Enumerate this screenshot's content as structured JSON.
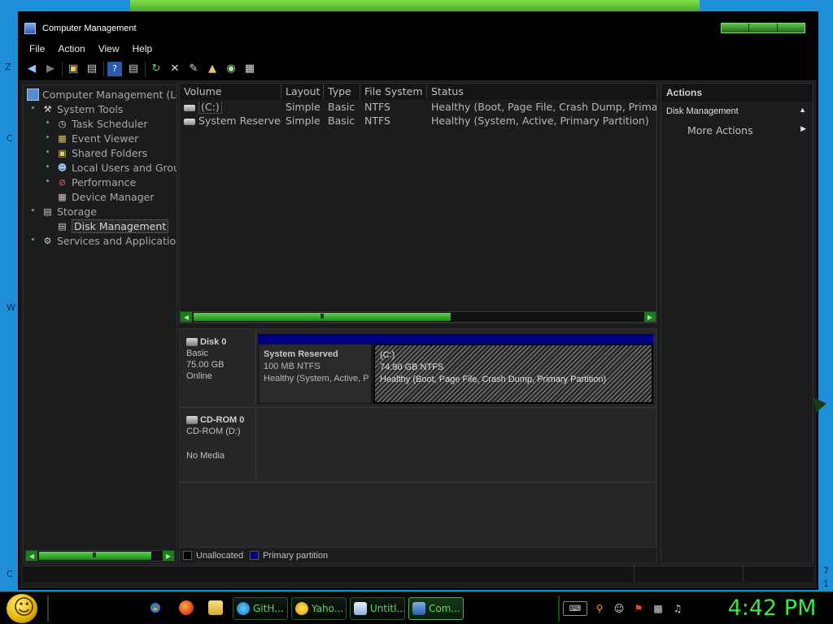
{
  "desktop": {
    "edge_letters": [
      "Z",
      "C",
      "W",
      "C",
      "7",
      "1"
    ]
  },
  "window": {
    "title": "Computer Management",
    "menu": [
      "File",
      "Action",
      "View",
      "Help"
    ]
  },
  "toolbar": {
    "icons": [
      "back-icon",
      "forward-icon",
      "up-folder-icon",
      "show-hide-tree-icon",
      "help-icon",
      "properties-icon",
      "refresh-icon",
      "delete-icon",
      "settings-icon",
      "open-icon",
      "search-icon",
      "export-icon"
    ]
  },
  "tree": {
    "items": [
      {
        "label": "Computer Management (Loc",
        "level": 0,
        "icon": "computer-icon"
      },
      {
        "label": "System Tools",
        "level": 1,
        "icon": "tools-icon"
      },
      {
        "label": "Task Scheduler",
        "level": 2,
        "icon": "clock-icon"
      },
      {
        "label": "Event Viewer",
        "level": 2,
        "icon": "event-viewer-icon"
      },
      {
        "label": "Shared Folders",
        "level": 2,
        "icon": "shared-folder-icon"
      },
      {
        "label": "Local Users and Grou",
        "level": 2,
        "icon": "users-icon"
      },
      {
        "label": "Performance",
        "level": 2,
        "icon": "performance-icon"
      },
      {
        "label": "Device Manager",
        "level": 2,
        "icon": "device-manager-icon"
      },
      {
        "label": "Storage",
        "level": 1,
        "icon": "storage-icon"
      },
      {
        "label": "Disk Management",
        "level": 2,
        "icon": "disk-icon"
      },
      {
        "label": "Services and Applications",
        "level": 1,
        "icon": "services-icon"
      }
    ],
    "selected_index": 9
  },
  "volumes": {
    "columns": [
      "Volume",
      "Layout",
      "Type",
      "File System",
      "Status"
    ],
    "rows": [
      {
        "volume": "(C:)",
        "layout": "Simple",
        "type": "Basic",
        "fs": "NTFS",
        "status": "Healthy (Boot, Page File, Crash Dump, Primary"
      },
      {
        "volume": "System Reserved",
        "layout": "Simple",
        "type": "Basic",
        "fs": "NTFS",
        "status": "Healthy (System, Active, Primary Partition)"
      }
    ]
  },
  "disks": [
    {
      "name": "Disk 0",
      "lines": [
        "Basic",
        "75.00 GB",
        "Online"
      ],
      "partitions": [
        {
          "title": "System Reserved",
          "size": "100 MB NTFS",
          "status": "Healthy (System, Active, P"
        },
        {
          "title": "(C:)",
          "size": "74.90 GB NTFS",
          "status": "Healthy (Boot, Page File, Crash Dump, Primary Partition)"
        }
      ]
    },
    {
      "name": "CD-ROM 0",
      "lines": [
        "CD-ROM (D:)",
        "",
        "No Media"
      ]
    }
  ],
  "legend": {
    "unallocated": "Unallocated",
    "primary": "Primary partition",
    "unallocated_color": "#000000",
    "primary_color": "#000080"
  },
  "actions": {
    "header": "Actions",
    "section": "Disk Management",
    "item": "More Actions"
  },
  "taskbar": {
    "buttons": [
      {
        "label": "GitH...",
        "color": "#1f8fe0"
      },
      {
        "label": "Yaho...",
        "color": "#f0c020"
      },
      {
        "label": "Untitl...",
        "color": "#8fb0d8"
      },
      {
        "label": "Com...",
        "color": "#4a80d0"
      }
    ],
    "clock": "4:42 PM"
  },
  "colors": {
    "accent_green": "#3ce83c",
    "primary_partition_blue": "#000080",
    "window_bg": "#1b1c1e"
  }
}
